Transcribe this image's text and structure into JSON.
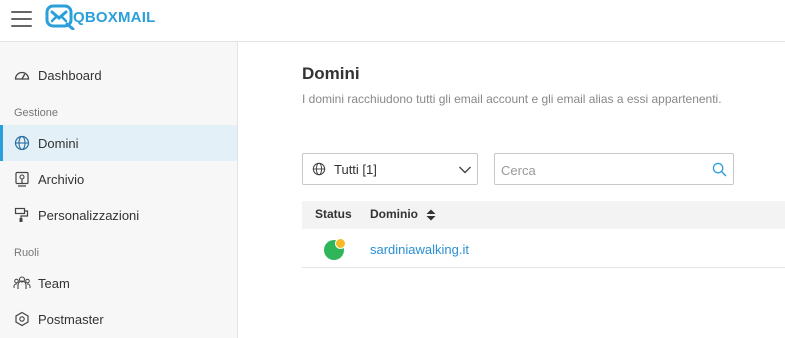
{
  "header": {
    "brand": "QBOXMAIL",
    "menu_icon": "hamburger-menu-icon",
    "logo_icon": "envelope-logo-icon",
    "brand_color": "#2b9fd9"
  },
  "sidebar": {
    "items": [
      {
        "label": "Dashboard",
        "icon": "speedometer-icon"
      }
    ],
    "sections": [
      {
        "label": "Gestione",
        "items": [
          {
            "label": "Domini",
            "icon": "globe-icon",
            "active": true
          },
          {
            "label": "Archivio",
            "icon": "archive-icon"
          },
          {
            "label": "Personalizzazioni",
            "icon": "customize-icon"
          }
        ]
      },
      {
        "label": "Ruoli",
        "items": [
          {
            "label": "Team",
            "icon": "team-icon"
          },
          {
            "label": "Postmaster",
            "icon": "postmaster-icon"
          }
        ]
      }
    ]
  },
  "main": {
    "title": "Domini",
    "subtitle": "I domini racchiudono tutti gli email account e gli email alias a essi appartenenti.",
    "filter": {
      "value": "Tutti [1]",
      "icon": "globe-icon"
    },
    "search": {
      "placeholder": "Cerca",
      "value": "",
      "icon": "search-icon"
    },
    "table": {
      "columns": [
        "Status",
        "Dominio"
      ],
      "rows": [
        {
          "status_colors": [
            "#2fb65a",
            "#f7b924"
          ],
          "domain": "sardiniawalking.it"
        }
      ]
    }
  }
}
